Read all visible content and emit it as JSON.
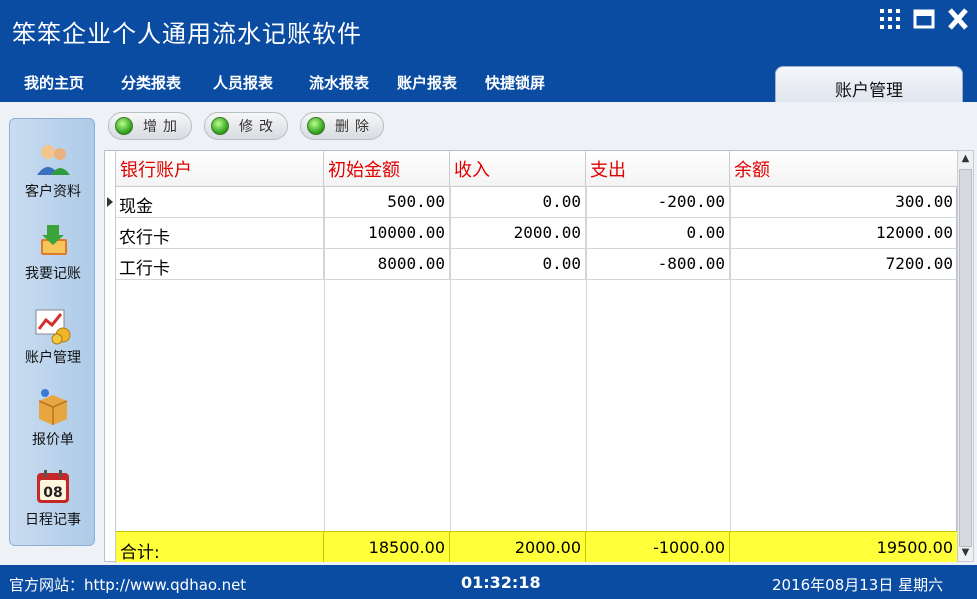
{
  "app": {
    "title": "笨笨企业个人通用流水记账软件"
  },
  "menu": [
    "我的主页",
    "分类报表",
    "人员报表",
    "流水报表",
    "账户报表",
    "快捷锁屏"
  ],
  "active_tab": "账户管理",
  "sidebar": [
    {
      "label": "客户资料",
      "icon": "customer-icon"
    },
    {
      "label": "我要记账",
      "icon": "bookkeeping-icon"
    },
    {
      "label": "账户管理",
      "icon": "account-chart-icon"
    },
    {
      "label": "报价单",
      "icon": "package-icon"
    },
    {
      "label": "日程记事",
      "icon": "calendar-icon",
      "icon_text": "08"
    }
  ],
  "toolbar": {
    "add": "增加",
    "edit": "修改",
    "delete": "删除"
  },
  "grid": {
    "columns": [
      "银行账户",
      "初始金额",
      "收入",
      "支出",
      "余额"
    ],
    "rows": [
      [
        "现金",
        "500.00",
        "0.00",
        "-200.00",
        "300.00"
      ],
      [
        "农行卡",
        "10000.00",
        "2000.00",
        "0.00",
        "12000.00"
      ],
      [
        "工行卡",
        "8000.00",
        "0.00",
        "-800.00",
        "7200.00"
      ]
    ],
    "total": [
      "合计:",
      "18500.00",
      "2000.00",
      "-1000.00",
      "19500.00"
    ]
  },
  "status": {
    "site": "官方网站：http://www.qdhao.net",
    "time": "01:32:18",
    "date": "2016年08月13日  星期六"
  },
  "colors": {
    "brand": "#0b4ca3",
    "header_text": "#e00000",
    "total_bg": "#ffff3a"
  }
}
